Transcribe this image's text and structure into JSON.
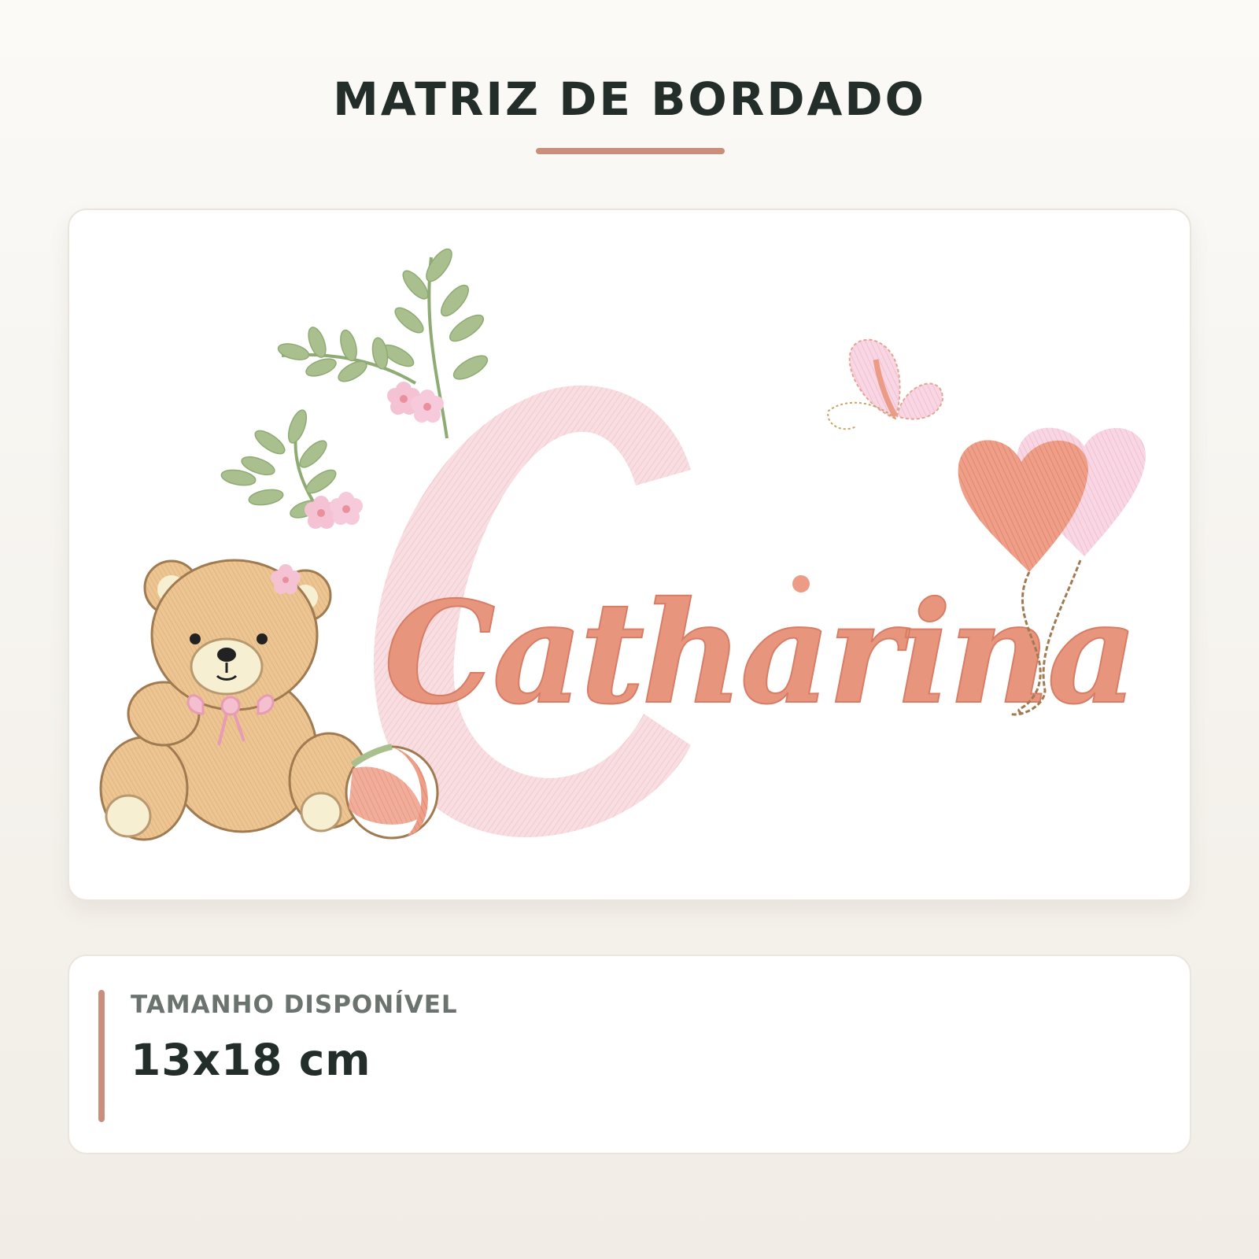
{
  "header": {
    "title": "MATRIZ DE BORDADO"
  },
  "design": {
    "name_text": "Catharina",
    "monogram_letter": "C",
    "motifs": [
      "teddy-bear",
      "leaf-sprigs",
      "pink-flowers",
      "beach-ball",
      "butterfly",
      "heart-balloons"
    ],
    "colors": {
      "name": "#e8957e",
      "letter": "#f6d6db",
      "leaf": "#a7bf8b",
      "bear": "#e9c08d",
      "flower": "#f3bfd0",
      "balloon_front": "#ec9c86",
      "balloon_back": "#f6cfdf"
    }
  },
  "size_info": {
    "label": "TAMANHO DISPONÍVEL",
    "value": "13x18 cm"
  },
  "accent_color": "#c98f7c"
}
